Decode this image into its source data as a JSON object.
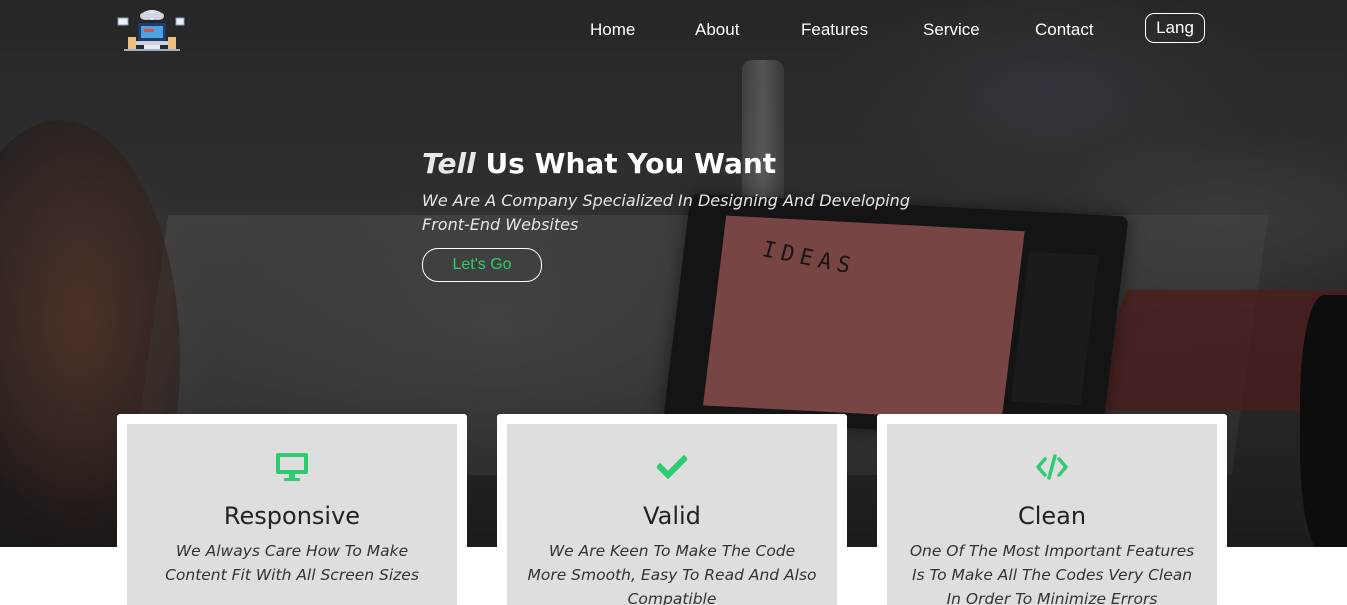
{
  "header": {
    "nav": [
      "Home",
      "About",
      "Features",
      "Service",
      "Contact"
    ],
    "lang_label": "Lang",
    "logo_icon": "laptop-illustration-logo"
  },
  "hero": {
    "title_accent": "Tell",
    "title_rest": "Us What You Want",
    "subtitle": "We Are A Company Specialized In Designing And Developing Front-End Websites",
    "cta_label": "Let's Go",
    "laptop_word": "IDEAS"
  },
  "features": [
    {
      "icon": "desktop-icon",
      "title": "Responsive",
      "text": "We Always Care How To Make Content Fit With All Screen Sizes"
    },
    {
      "icon": "check-icon",
      "title": "Valid",
      "text": "We Are Keen To Make The Code More Smooth, Easy To Read And Also Compatible"
    },
    {
      "icon": "code-icon",
      "title": "Clean",
      "text": "One Of The Most Important Features Is To Make All The Codes Very Clean In Order To Minimize Errors"
    }
  ],
  "colors": {
    "accent": "#2ecc71",
    "card_bg": "#dedede",
    "text_dark": "#222222"
  }
}
